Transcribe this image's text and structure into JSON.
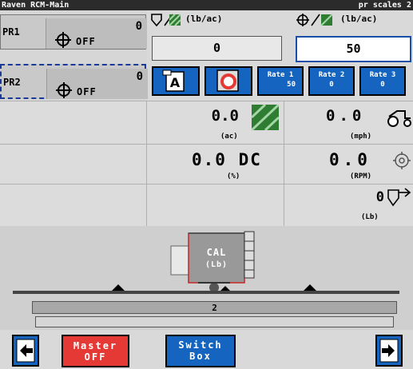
{
  "titlebar": {
    "left": "Raven RCM-Main",
    "right": "pr scales 2"
  },
  "products": [
    {
      "name": "PR1",
      "value": "0",
      "status": "OFF"
    },
    {
      "name": "PR2",
      "value": "0",
      "status": "OFF"
    }
  ],
  "rate_headers": {
    "actual_unit": "(lb/ac)",
    "target_unit": "(lb/ac)"
  },
  "rate_boxes": {
    "actual": "0",
    "target": "50"
  },
  "rate_buttons": [
    {
      "label": "Rate 1",
      "value": "50"
    },
    {
      "label": "Rate 2",
      "value": "0"
    },
    {
      "label": "Rate 3",
      "value": "0"
    }
  ],
  "readouts": {
    "area": {
      "value": "0.0",
      "unit": "(ac)"
    },
    "speed": {
      "value": "0.0",
      "unit": "(mph)"
    },
    "duty": {
      "value": "0.0 DC",
      "unit": "(%)"
    },
    "rpm": {
      "value": "0.0",
      "unit": "(RPM)"
    },
    "weight": {
      "value": "0",
      "unit": "(Lb)"
    }
  },
  "tank": {
    "label": "CAL",
    "unit": "(Lb)"
  },
  "section_bar": {
    "label": "2"
  },
  "footer": {
    "master_line1": "Master",
    "master_line2": "OFF",
    "switch_line1": "Switch",
    "switch_line2": "Box"
  },
  "colors": {
    "accent": "#1565c0",
    "master": "#e53935",
    "hatch": "#2e7d32"
  }
}
